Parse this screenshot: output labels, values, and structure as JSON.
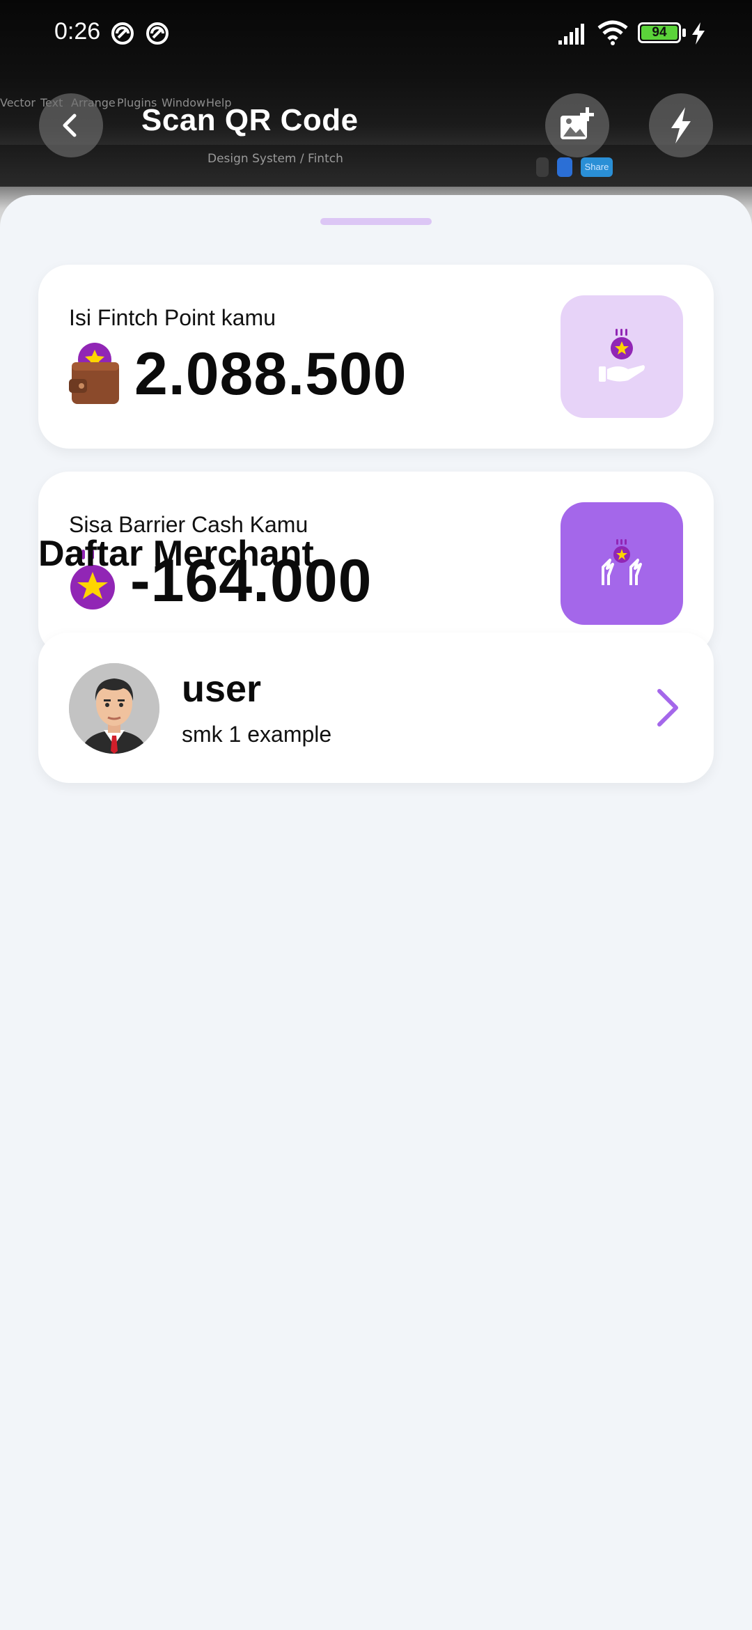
{
  "status_bar": {
    "time": "0:26",
    "battery": "94"
  },
  "camera_background": {
    "menu": [
      "Vector",
      "Text",
      "Arrange",
      "Plugins",
      "Window",
      "Help"
    ],
    "breadcrumb": "Design System / Fintch",
    "tab_label": "Share"
  },
  "header": {
    "title": "Scan QR Code",
    "back_icon": "arrow-back-icon",
    "gallery_icon": "image-add-icon",
    "flash_icon": "flash-icon"
  },
  "cards": {
    "points": {
      "label": "Isi Fintch Point kamu",
      "value": "2.088.500",
      "icon": "wallet-icon",
      "action_icon": "coin-hand-icon"
    },
    "barrier": {
      "label": "Sisa Barrier Cash Kamu",
      "value": "-164.000",
      "icon": "star-coin-icon",
      "action_icon": "barrier-coin-icon"
    }
  },
  "section": {
    "title": "Daftar Merchant"
  },
  "merchants": [
    {
      "name": "user",
      "subtitle": "smk 1 example",
      "avatar": "avatar-man-icon"
    }
  ],
  "colors": {
    "accent": "#a467ea",
    "accent_light": "#e7d3f8",
    "coin": "#9126b5",
    "star": "#ffd500",
    "background": "#f2f5f9"
  }
}
